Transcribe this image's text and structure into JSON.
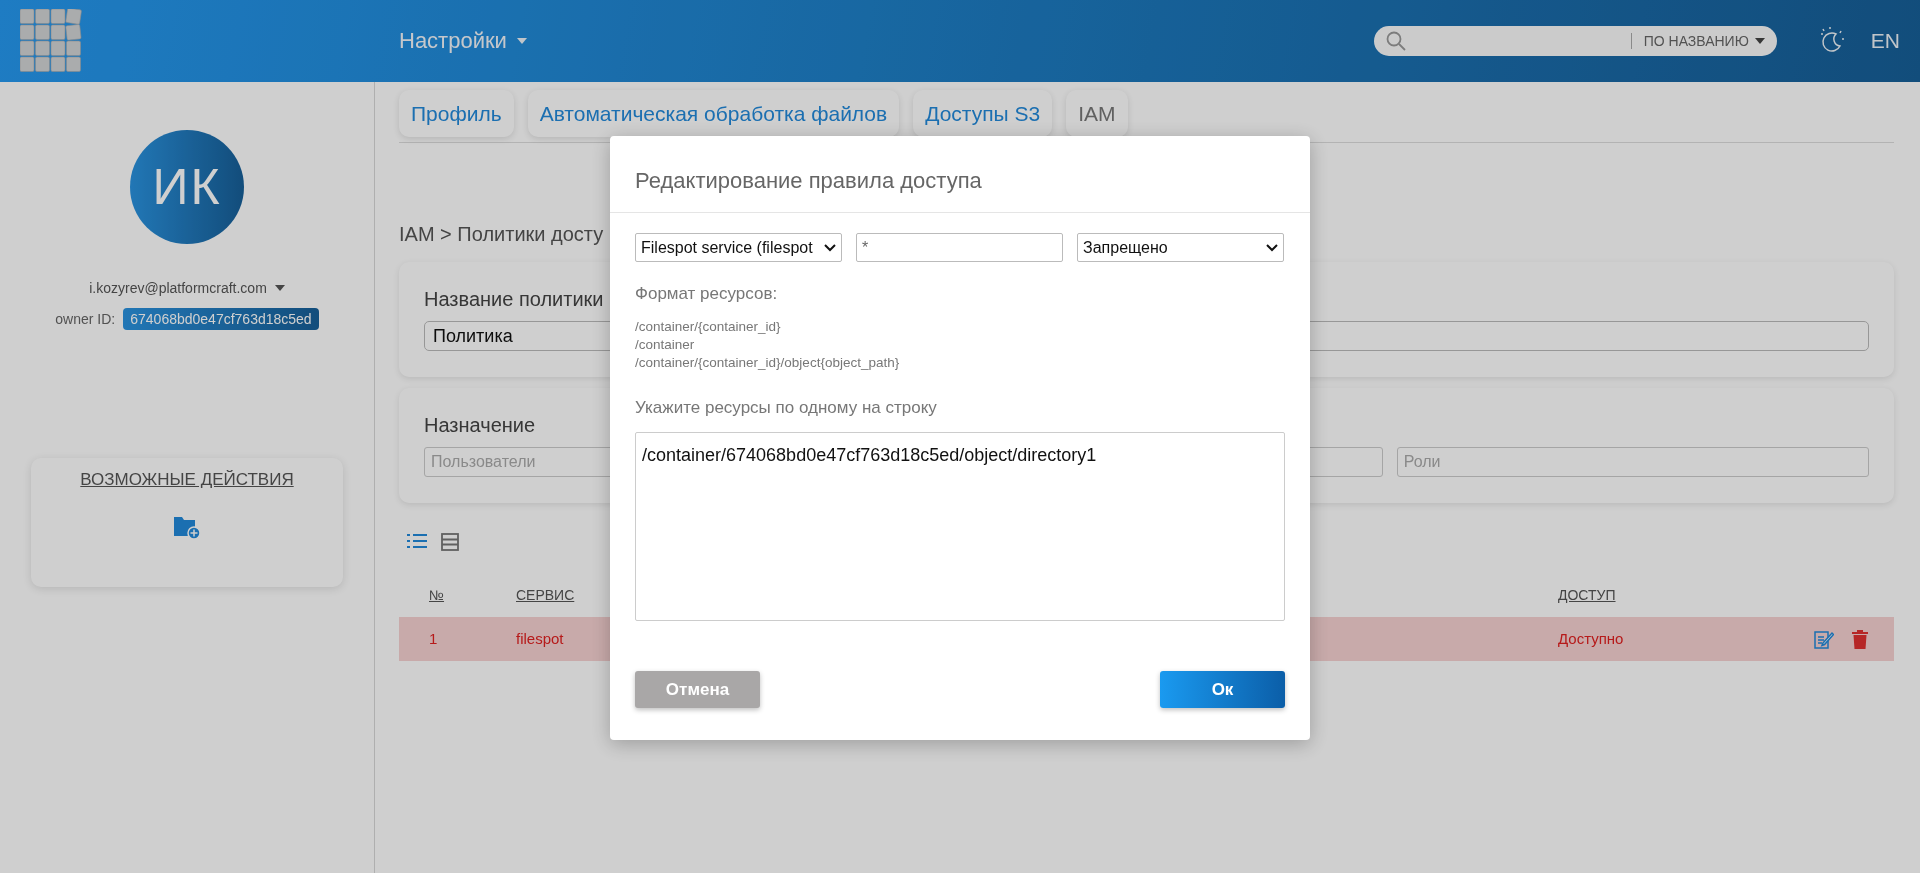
{
  "header": {
    "title": "Настройки",
    "search_filter": "ПО НАЗВАНИЮ",
    "language": "EN"
  },
  "profile": {
    "initials": "ИК",
    "email": "i.kozyrev@platformcraft.com",
    "owner_label": "owner ID:",
    "owner_id": "674068bd0e47cf763d18c5ed"
  },
  "actions": {
    "title": "ВОЗМОЖНЫЕ ДЕЙСТВИЯ"
  },
  "tabs": [
    {
      "label": "Профиль",
      "selected": false
    },
    {
      "label": "Автоматическая обработка файлов",
      "selected": false
    },
    {
      "label": "Доступы S3",
      "selected": false
    },
    {
      "label": "IAM",
      "selected": true
    }
  ],
  "breadcrumb": "IAM > Политики досту",
  "policy": {
    "label": "Название политики",
    "value": "Политика"
  },
  "assignment": {
    "label": "Назначение",
    "users_placeholder": "Пользователи",
    "roles_placeholder": "Роли"
  },
  "view_modes": [
    {
      "kind": "list",
      "selected": true
    },
    {
      "kind": "table",
      "selected": false
    }
  ],
  "table": {
    "columns": [
      "№",
      "СЕРВИС",
      "ДОСТУП"
    ],
    "rows": [
      {
        "cells": [
          "1",
          "filespot",
          "Доступно"
        ],
        "selected": true
      }
    ]
  },
  "dialog": {
    "title": "Редактирование правила доступа",
    "service": "Filespot service (filespot",
    "action": "*",
    "effect": "Запрещено",
    "format_label": "Формат ресурсов:",
    "formats": [
      "/container/{container_id}",
      "/container",
      "/container/{container_id}/object{object_path}"
    ],
    "resources_label": "Укажите ресурсы по одному на строку",
    "resources": "/container/674068bd0e47cf763d18c5ed/object/directory1",
    "cancel": "Отмена",
    "ok": "Ок"
  }
}
